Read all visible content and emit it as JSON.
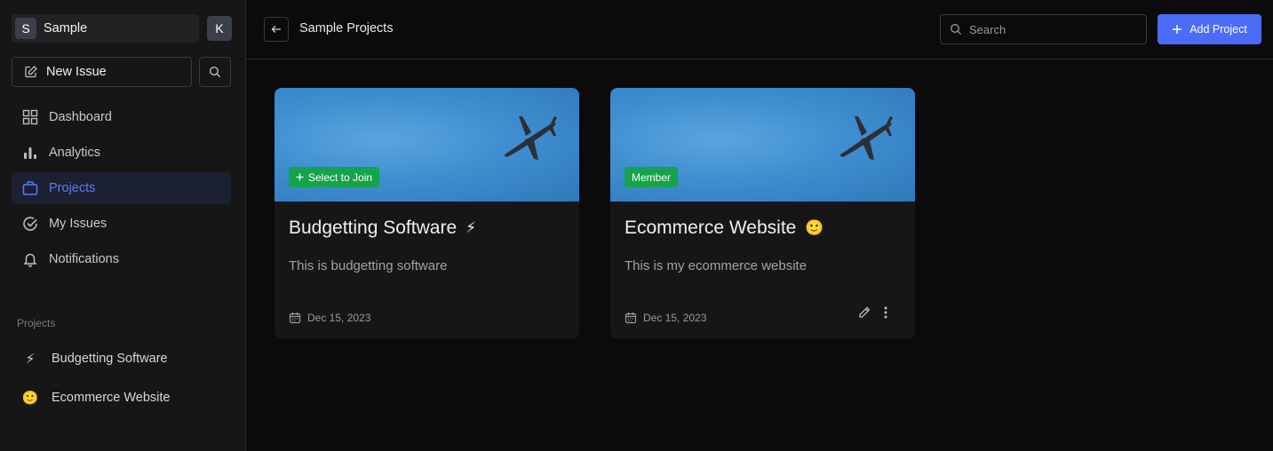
{
  "workspace": {
    "avatar": "S",
    "name": "Sample"
  },
  "user": {
    "avatar": "K"
  },
  "sidebar": {
    "new_issue_label": "New Issue",
    "nav": [
      {
        "label": "Dashboard",
        "icon": "grid-icon"
      },
      {
        "label": "Analytics",
        "icon": "bar-chart-icon"
      },
      {
        "label": "Projects",
        "icon": "briefcase-icon"
      },
      {
        "label": "My Issues",
        "icon": "check-circle-icon"
      },
      {
        "label": "Notifications",
        "icon": "bell-icon"
      }
    ],
    "active_nav": "Projects",
    "projects_heading": "Projects",
    "projects": [
      {
        "emoji": "⚡",
        "name": "Budgetting Software"
      },
      {
        "emoji": "🙂",
        "name": "Ecommerce Website"
      }
    ]
  },
  "header": {
    "title": "Sample Projects",
    "search_placeholder": "Search",
    "add_project_label": "Add Project"
  },
  "cards": [
    {
      "badge": "Select to Join",
      "title": "Budgetting Software",
      "emoji": "⚡",
      "description": "This is budgetting software",
      "date": "Dec 15, 2023"
    },
    {
      "badge": "Member",
      "title": "Ecommerce Website",
      "emoji": "🙂",
      "description": "This is my ecommerce website",
      "date": "Dec 15, 2023"
    }
  ],
  "colors": {
    "accent": "#4a6cf7",
    "badge_green": "#16a34a",
    "active_nav_bg": "#1c2033"
  }
}
